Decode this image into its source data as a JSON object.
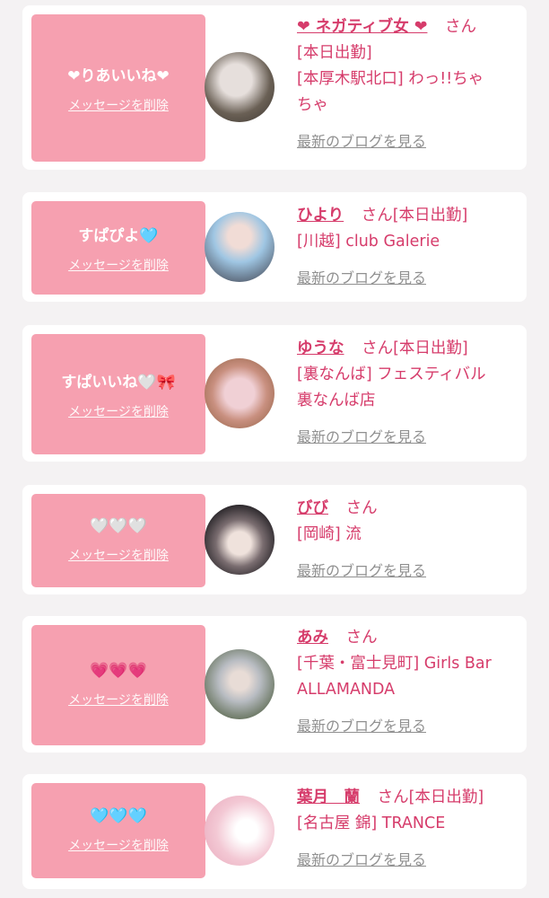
{
  "cards": [
    {
      "message": "❤りあいいね❤",
      "delete_label": "メッセージを削除",
      "name": "❤ ネガティブ女 ❤",
      "san": "さん",
      "lines": [
        "[本日出勤]",
        "[本厚木駅北口] わっ!!ちゃ",
        "ちゃ"
      ],
      "blog_label": "最新のブログを見る",
      "avatar_colors": [
        "#6a6055",
        "#e6dfdc"
      ]
    },
    {
      "message": "すぱぴよ🩵",
      "delete_label": "メッセージを削除",
      "name": "ひより",
      "san": "さん",
      "san_suffix": "[本日出勤]",
      "lines": [
        "[川越] club Galerie"
      ],
      "blog_label": "最新のブログを見る",
      "avatar_colors": [
        "#3a3a45",
        "#9fc6e3"
      ]
    },
    {
      "message": "すぱいいね🤍🎀",
      "delete_label": "メッセージを削除",
      "name": "ゆうな",
      "san": "さん",
      "san_suffix": "[本日出勤]",
      "lines": [
        "[裏なんば] フェスティバル",
        "裏なんば店"
      ],
      "blog_label": "最新のブログを見る",
      "avatar_colors": [
        "#f0d0d5",
        "#8a5a3c"
      ]
    },
    {
      "message": "🤍🤍🤍",
      "delete_label": "メッセージを削除",
      "name": "びび",
      "san": "さん",
      "lines": [
        "[岡崎] 流"
      ],
      "blog_label": "最新のブログを見る",
      "avatar_colors": [
        "#1c1a1e",
        "#d9c8c2"
      ]
    },
    {
      "message": "💗💗💗",
      "delete_label": "メッセージを削除",
      "name": "あみ",
      "san": "さん",
      "lines": [
        "[千葉・富士見町] Girls Bar",
        "ALLAMANDA"
      ],
      "blog_label": "最新のブログを見る",
      "avatar_colors": [
        "#4a5a3a",
        "#b8bcc2"
      ]
    },
    {
      "message": "🩵🩵🩵",
      "delete_label": "メッセージを削除",
      "name": "葉月　蘭",
      "san": "さん",
      "san_suffix": "[本日出勤]",
      "lines": [
        "[名古屋 錦] TRANCE"
      ],
      "blog_label": "最新のブログを見る",
      "avatar_colors": [
        "#f3c8d4",
        "#ffffff"
      ]
    }
  ]
}
